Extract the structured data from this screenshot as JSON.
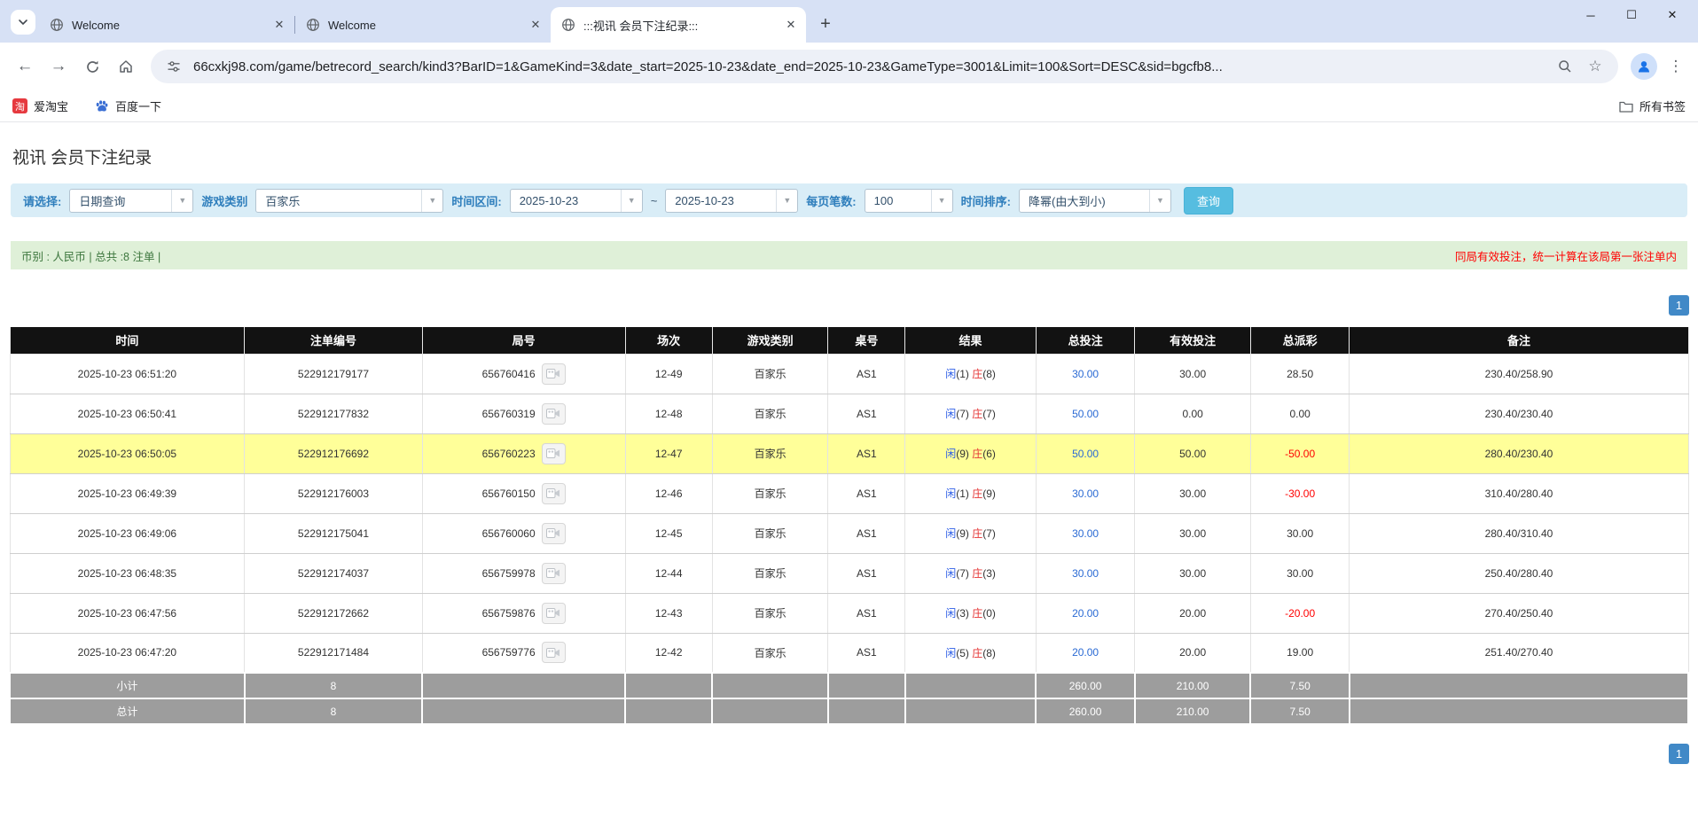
{
  "browser": {
    "tabs": [
      {
        "title": "Welcome"
      },
      {
        "title": "Welcome"
      },
      {
        "title": ":::视讯 会员下注纪录:::"
      }
    ],
    "new_tab": "+",
    "window_controls": {
      "minimize": "─",
      "maximize": "☐",
      "close": "✕"
    },
    "url": "66cxkj98.com/game/betrecord_search/kind3?BarID=1&GameKind=3&date_start=2025-10-23&date_end=2025-10-23&GameType=3001&Limit=100&Sort=DESC&sid=bgcfb8...",
    "bookmarks": [
      {
        "label": "爱淘宝",
        "icon_char": "淘"
      },
      {
        "label": "百度一下"
      }
    ],
    "bookmarks_right": "所有书签"
  },
  "page": {
    "title": "视讯 会员下注纪录",
    "filters": {
      "select_label": "请选择:",
      "select_value": "日期查询",
      "game_type_label": "游戏类别",
      "game_type_value": "百家乐",
      "date_range_label": "时间区间:",
      "date_start": "2025-10-23",
      "tilde": "~",
      "date_end": "2025-10-23",
      "per_page_label": "每页笔数:",
      "per_page_value": "100",
      "sort_label": "时间排序:",
      "sort_value": "降幂(由大到小)",
      "search_button": "查询"
    },
    "summary_left": "币别 : 人民币 | 总共 :8 注单 |",
    "summary_right": "同局有效投注，统一计算在该局第一张注单内",
    "pagination_page": "1"
  },
  "table": {
    "columns": [
      "时间",
      "注单编号",
      "局号",
      "场次",
      "游戏类别",
      "桌号",
      "结果",
      "总投注",
      "有效投注",
      "总派彩",
      "备注"
    ],
    "result_labels": {
      "player": "闲",
      "banker": "庄"
    },
    "rows": [
      {
        "time": "2025-10-23 06:51:20",
        "bet_id": "522912179177",
        "round_id": "656760416",
        "session": "12-49",
        "game": "百家乐",
        "table_no": "AS1",
        "player": "1",
        "banker": "8",
        "total_bet": "30.00",
        "valid_bet": "30.00",
        "payout": "28.50",
        "note": "230.40/258.90",
        "highlight": false
      },
      {
        "time": "2025-10-23 06:50:41",
        "bet_id": "522912177832",
        "round_id": "656760319",
        "session": "12-48",
        "game": "百家乐",
        "table_no": "AS1",
        "player": "7",
        "banker": "7",
        "total_bet": "50.00",
        "valid_bet": "0.00",
        "payout": "0.00",
        "note": "230.40/230.40",
        "highlight": false
      },
      {
        "time": "2025-10-23 06:50:05",
        "bet_id": "522912176692",
        "round_id": "656760223",
        "session": "12-47",
        "game": "百家乐",
        "table_no": "AS1",
        "player": "9",
        "banker": "6",
        "total_bet": "50.00",
        "valid_bet": "50.00",
        "payout": "-50.00",
        "note": "280.40/230.40",
        "highlight": true
      },
      {
        "time": "2025-10-23 06:49:39",
        "bet_id": "522912176003",
        "round_id": "656760150",
        "session": "12-46",
        "game": "百家乐",
        "table_no": "AS1",
        "player": "1",
        "banker": "9",
        "total_bet": "30.00",
        "valid_bet": "30.00",
        "payout": "-30.00",
        "note": "310.40/280.40",
        "highlight": false
      },
      {
        "time": "2025-10-23 06:49:06",
        "bet_id": "522912175041",
        "round_id": "656760060",
        "session": "12-45",
        "game": "百家乐",
        "table_no": "AS1",
        "player": "9",
        "banker": "7",
        "total_bet": "30.00",
        "valid_bet": "30.00",
        "payout": "30.00",
        "note": "280.40/310.40",
        "highlight": false
      },
      {
        "time": "2025-10-23 06:48:35",
        "bet_id": "522912174037",
        "round_id": "656759978",
        "session": "12-44",
        "game": "百家乐",
        "table_no": "AS1",
        "player": "7",
        "banker": "3",
        "total_bet": "30.00",
        "valid_bet": "30.00",
        "payout": "30.00",
        "note": "250.40/280.40",
        "highlight": false
      },
      {
        "time": "2025-10-23 06:47:56",
        "bet_id": "522912172662",
        "round_id": "656759876",
        "session": "12-43",
        "game": "百家乐",
        "table_no": "AS1",
        "player": "3",
        "banker": "0",
        "total_bet": "20.00",
        "valid_bet": "20.00",
        "payout": "-20.00",
        "note": "270.40/250.40",
        "highlight": false
      },
      {
        "time": "2025-10-23 06:47:20",
        "bet_id": "522912171484",
        "round_id": "656759776",
        "session": "12-42",
        "game": "百家乐",
        "table_no": "AS1",
        "player": "5",
        "banker": "8",
        "total_bet": "20.00",
        "valid_bet": "20.00",
        "payout": "19.00",
        "note": "251.40/270.40",
        "highlight": false
      }
    ],
    "subtotal": {
      "label": "小计",
      "count": "8",
      "total_bet": "260.00",
      "valid_bet": "210.00",
      "payout": "7.50"
    },
    "total": {
      "label": "总计",
      "count": "8",
      "total_bet": "260.00",
      "valid_bet": "210.00",
      "payout": "7.50"
    }
  },
  "colors": {
    "accent_blue": "#4189c7",
    "highlight_yellow": "#ffff99",
    "negative_red": "#ff0000",
    "header_black": "#121212",
    "filter_bg": "#d9edf7",
    "summary_bg": "#dff0d8"
  }
}
